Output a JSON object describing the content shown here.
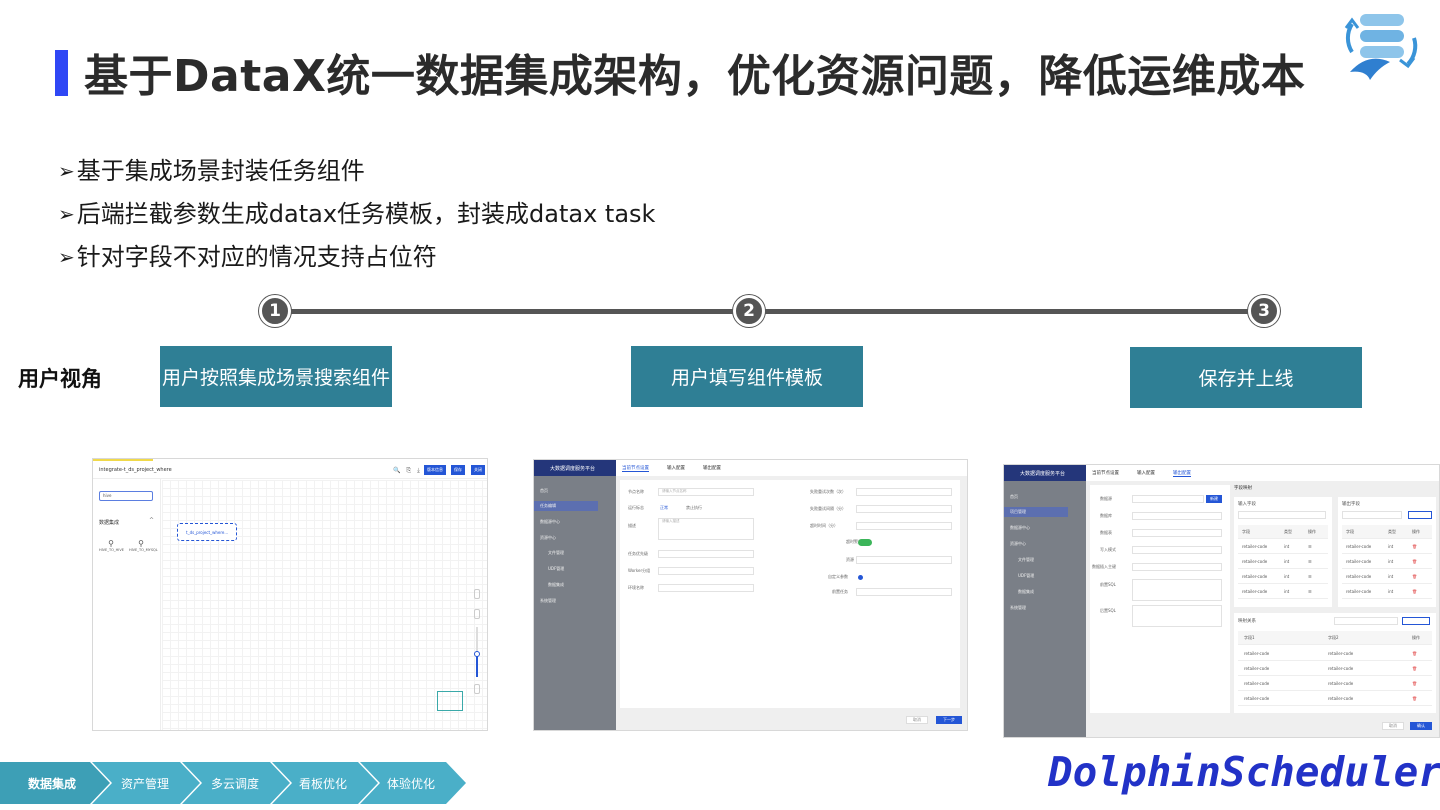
{
  "title": "基于DataX统一数据集成架构，优化资源问题，降低运维成本",
  "bullets": [
    "基于集成场景封装任务组件",
    "后端拦截参数生成datax任务模板，封装成datax task",
    "针对字段不对应的情况支持占位符"
  ],
  "bullet_marker": "➢",
  "user_view_label": "用户视角",
  "steps": [
    {
      "number": "1",
      "label": "用户按照集成场景搜索组件"
    },
    {
      "number": "2",
      "label": "用户填写组件模板"
    },
    {
      "number": "3",
      "label": "保存并上线"
    }
  ],
  "shot1": {
    "title": "integrate-t_ds_project_where",
    "buttons": [
      "版本信息",
      "保存",
      "关闭"
    ],
    "search_value": "hive",
    "group_label": "数据集成",
    "components": [
      "HIVE_TO_HIVE",
      "HIVE_TO_MYSQL"
    ],
    "node_label": "t_ds_project_where..."
  },
  "shot2": {
    "app_name": "大数据调度服务平台",
    "sidebar": [
      "首页",
      "任务编辑",
      "数据源中心",
      "资源中心",
      "文件管理",
      "UDF管理",
      "数据集成",
      "系统管理"
    ],
    "tabs": [
      "当前节点设置",
      "输入配置",
      "输出配置"
    ],
    "left_fields": [
      "节点名称",
      "运行标志",
      "描述",
      "任务优先级",
      "Worker分组",
      "环境名称"
    ],
    "right_fields": [
      "失败重试次数（次）",
      "失败重试间隔（分）",
      "超时时间（分）",
      "超时警告",
      "资源",
      "自定义参数",
      "前置任务"
    ],
    "name_placeholder": "请输入节点名称",
    "desc_placeholder": "请输入描述",
    "run_options": [
      "正常",
      "禁止执行"
    ],
    "cancel": "取消",
    "next": "下一步"
  },
  "shot3": {
    "app_name": "大数据调度服务平台",
    "sidebar": [
      "首页",
      "项目管理",
      "数据源中心",
      "资源中心",
      "文件管理",
      "UDF管理",
      "数据集成",
      "系统管理"
    ],
    "tabs": [
      "当前节点设置",
      "输入配置",
      "输出配置"
    ],
    "fields": [
      "数据源",
      "数据库",
      "数据表",
      "写入模式",
      "数据插入主键",
      "前置SQL",
      "后置SQL"
    ],
    "new_button": "新建",
    "mapping_title": "字段映射",
    "input_fields_label": "输入字段",
    "output_fields_label": "输出字段",
    "field_header": [
      "字段",
      "类型",
      "操作"
    ],
    "field_rows": [
      {
        "name": "retailer-code",
        "type": "int"
      },
      {
        "name": "retailer-code",
        "type": "int"
      },
      {
        "name": "retailer-code",
        "type": "int"
      },
      {
        "name": "retailer-code",
        "type": "int"
      }
    ],
    "relation_title": "映射关系",
    "relation_header": [
      "字段1",
      "字段2",
      "操作"
    ],
    "relation_rows": [
      [
        "retailer-code",
        "retailer-code"
      ],
      [
        "retailer-code",
        "retailer-code"
      ],
      [
        "retailer-code",
        "retailer-code"
      ],
      [
        "retailer-code",
        "retailer-code"
      ]
    ],
    "cancel": "取消",
    "confirm": "确认"
  },
  "bottom_nav": [
    "数据集成",
    "资产管理",
    "多云调度",
    "看板优化",
    "体验优化"
  ],
  "brand": "DolphinScheduler",
  "colors": {
    "accent_blue": "#2f47f5",
    "step_box": "#2f7f95",
    "timeline": "#555555",
    "nav_dark": "#3d9fb6",
    "nav_light": "#4aafc8",
    "brand": "#2232c7"
  }
}
